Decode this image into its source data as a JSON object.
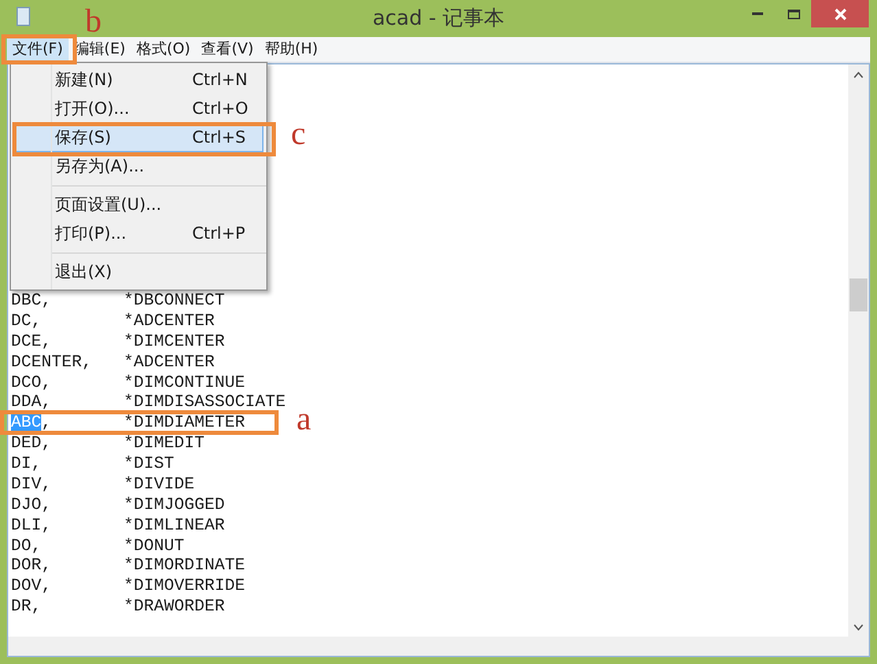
{
  "window": {
    "title": "acad - 记事本"
  },
  "menu_bar": [
    {
      "label": "文件(F)",
      "selected": true
    },
    {
      "label": "编辑(E)",
      "selected": false
    },
    {
      "label": "格式(O)",
      "selected": false
    },
    {
      "label": "查看(V)",
      "selected": false
    },
    {
      "label": "帮助(H)",
      "selected": false
    }
  ],
  "file_menu": {
    "items": [
      {
        "kind": "item",
        "label": "新建(N)",
        "shortcut": "Ctrl+N",
        "selected": false
      },
      {
        "kind": "item",
        "label": "打开(O)...",
        "shortcut": "Ctrl+O",
        "selected": false
      },
      {
        "kind": "item",
        "label": "保存(S)",
        "shortcut": "Ctrl+S",
        "selected": true
      },
      {
        "kind": "item",
        "label": "另存为(A)...",
        "selected": false
      },
      {
        "kind": "separator"
      },
      {
        "kind": "item",
        "label": "页面设置(U)...",
        "selected": false
      },
      {
        "kind": "item",
        "label": "打印(P)...",
        "shortcut": "Ctrl+P",
        "selected": false
      },
      {
        "kind": "separator"
      },
      {
        "kind": "item",
        "label": "退出(X)",
        "selected": false
      }
    ]
  },
  "editor": {
    "lines": [
      {
        "key": "DBC,",
        "value": "*DBCONNECT",
        "selected": false
      },
      {
        "key": "DC,",
        "value": "*ADCENTER",
        "selected": false
      },
      {
        "key": "DCE,",
        "value": "*DIMCENTER",
        "selected": false
      },
      {
        "key": "DCENTER,",
        "value": "*ADCENTER",
        "selected": false
      },
      {
        "key": "DCO,",
        "value": "*DIMCONTINUE",
        "selected": false
      },
      {
        "key": "DDA,",
        "value": "*DIMDISASSOCIATE",
        "selected": false
      },
      {
        "key": "ABC,",
        "value": "*DIMDIAMETER",
        "selected": true
      },
      {
        "key": "DED,",
        "value": "*DIMEDIT",
        "selected": false
      },
      {
        "key": "DI,",
        "value": "*DIST",
        "selected": false
      },
      {
        "key": "DIV,",
        "value": "*DIVIDE",
        "selected": false
      },
      {
        "key": "DJO,",
        "value": "*DIMJOGGED",
        "selected": false
      },
      {
        "key": "DLI,",
        "value": "*DIMLINEAR",
        "selected": false
      },
      {
        "key": "DO,",
        "value": "*DONUT",
        "selected": false
      },
      {
        "key": "DOR,",
        "value": "*DIMORDINATE",
        "selected": false
      },
      {
        "key": "DOV,",
        "value": "*DIMOVERRIDE",
        "selected": false
      },
      {
        "key": "DR,",
        "value": "*DRAWORDER",
        "selected": false
      }
    ]
  },
  "annotations": [
    {
      "label": "b"
    },
    {
      "label": "c"
    },
    {
      "label": "a"
    }
  ]
}
